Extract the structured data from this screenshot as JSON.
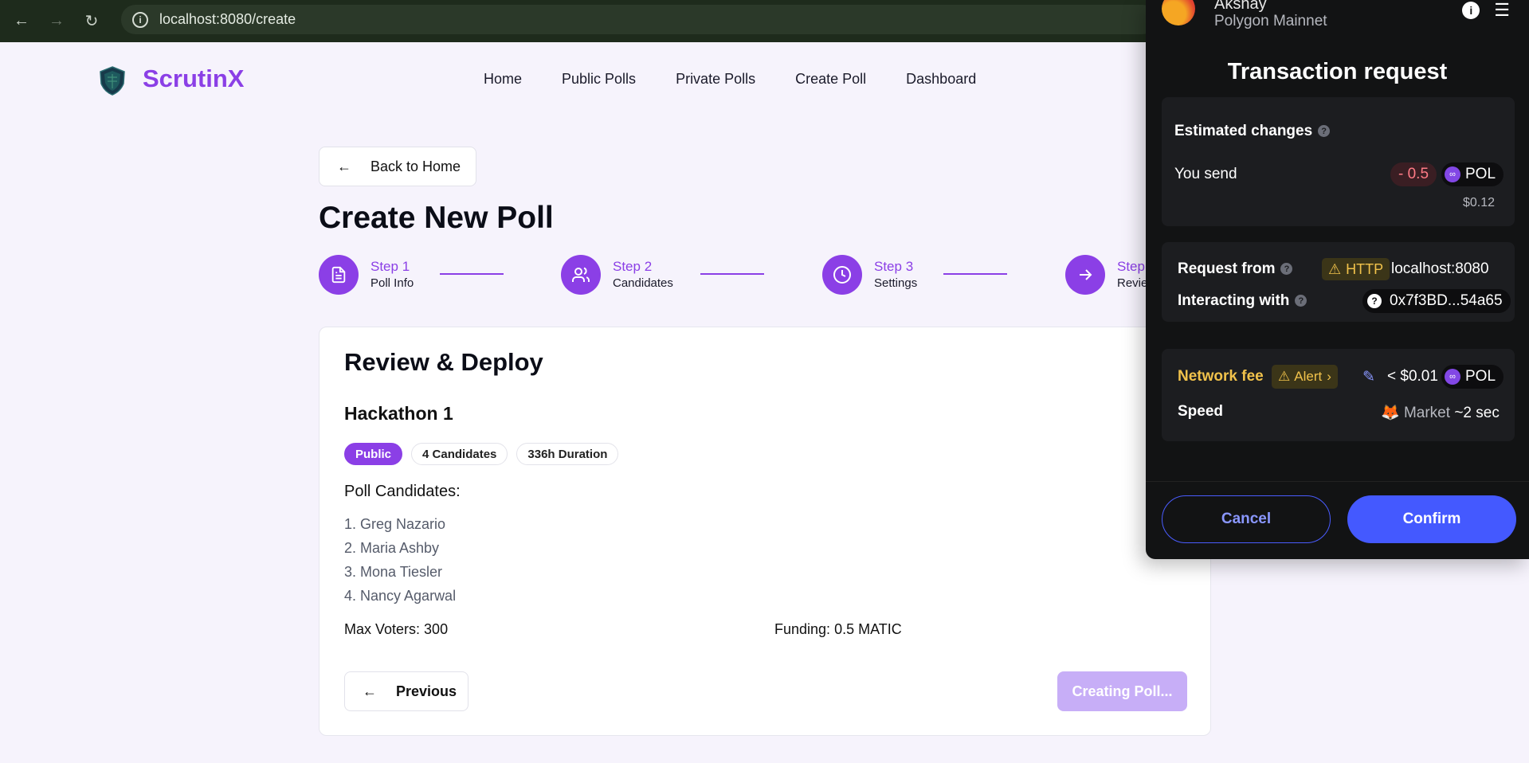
{
  "browser": {
    "url": "localhost:8080/create"
  },
  "header": {
    "brand": "ScrutinX",
    "nav": [
      "Home",
      "Public Polls",
      "Private Polls",
      "Create Poll",
      "Dashboard"
    ]
  },
  "page": {
    "back_label": "Back to Home",
    "title": "Create New Poll"
  },
  "steps": [
    {
      "label": "Step 1",
      "sub": "Poll Info"
    },
    {
      "label": "Step 2",
      "sub": "Candidates"
    },
    {
      "label": "Step 3",
      "sub": "Settings"
    },
    {
      "label": "Step",
      "sub": "Revie"
    }
  ],
  "review": {
    "title": "Review & Deploy",
    "poll_name": "Hackathon 1",
    "badges": [
      "Public",
      "4 Candidates",
      "336h Duration"
    ],
    "candidates_title": "Poll Candidates:",
    "candidates": [
      "1. Greg Nazario",
      "2. Maria Ashby",
      "3. Mona Tiesler",
      "4. Nancy Agarwal"
    ],
    "max_voters_label": "Max Voters:",
    "max_voters_value": " 300",
    "funding_label": "Funding:",
    "funding_value": " 0.5 MATIC",
    "previous_label": "Previous",
    "create_label": "Creating Poll..."
  },
  "wallet": {
    "account": "Akshay",
    "network": "Polygon Mainnet",
    "title": "Transaction request",
    "estimated_changes": "Estimated changes",
    "you_send": "You send",
    "send_amount": "- 0.5",
    "token": "POL",
    "send_usd": "$0.12",
    "request_from": "Request from",
    "http_badge": "HTTP",
    "origin": "localhost:8080",
    "interacting_with": "Interacting with",
    "contract": "0x7f3BD...54a65",
    "network_fee": "Network fee",
    "alert": "Alert",
    "fee_amount": "< $0.01",
    "speed_label": "Speed",
    "speed_market": "Market",
    "speed_time": "~2 sec",
    "cancel": "Cancel",
    "confirm": "Confirm"
  }
}
